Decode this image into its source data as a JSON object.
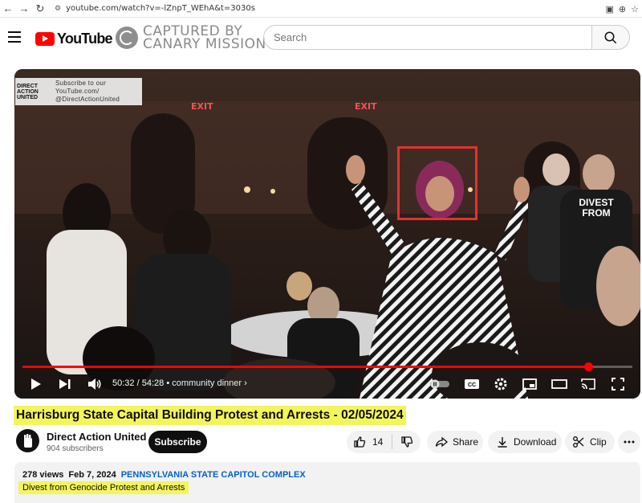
{
  "browser": {
    "url": "youtube.com/watch?v=-lZnpT_WEhA&t=3030s"
  },
  "header": {
    "logo_text": "YouTube",
    "watermark_line1": "CAPTURED BY",
    "watermark_line2": "CANARY MISSION",
    "search_placeholder": "Search"
  },
  "player": {
    "channel_watermark": {
      "logo_text": "DIRECT ACTION UNITED",
      "line1": "Subscribe to our",
      "line2": "YouTube.com/",
      "line3": "@DirectActionUnited"
    },
    "exit_sign": "EXIT",
    "shirt_text": "DIVEST FROM",
    "current_time": "50:32",
    "duration": "54:28",
    "chapter": "community dinner",
    "progress": 0.928
  },
  "video": {
    "title": "Harrisburg State Capital Building Protest and Arrests - 02/05/2024",
    "channel_name": "Direct Action United",
    "subscribers": "904 subscribers",
    "subscribe_label": "Subscribe",
    "likes": "14",
    "share_label": "Share",
    "download_label": "Download",
    "clip_label": "Clip"
  },
  "description": {
    "views": "278 views",
    "date": "Feb 7, 2024",
    "location": "PENNSYLVANIA STATE CAPITOL COMPLEX",
    "line1": "Divest from Genocide Protest and Arrests"
  },
  "colors": {
    "brand_red": "#ff0000",
    "highlight": "#f3f55d",
    "link": "#065fd4"
  }
}
